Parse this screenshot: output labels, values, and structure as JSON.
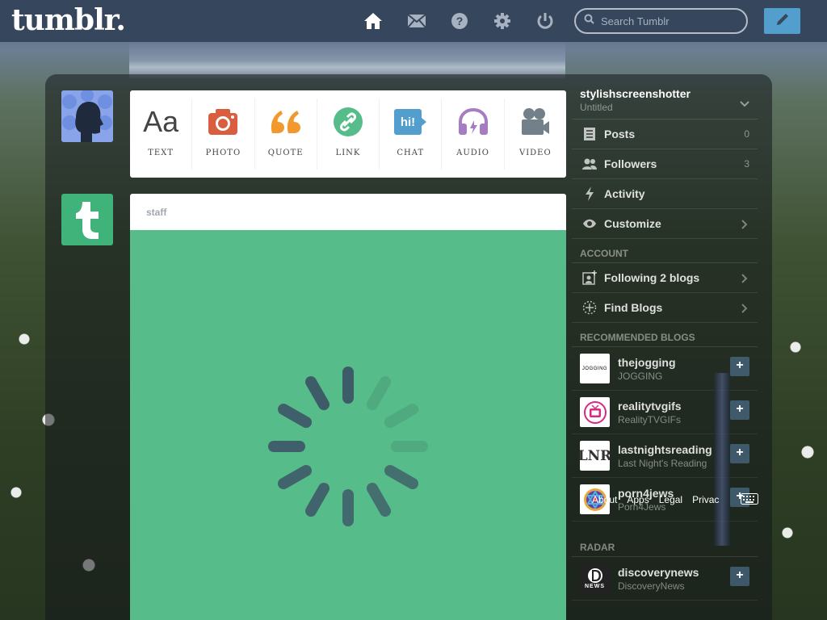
{
  "header": {
    "logo": "tumblr.",
    "search_placeholder": "Search Tumblr",
    "nav": [
      "home-icon",
      "mail-icon",
      "help-icon",
      "gear-icon",
      "power-icon"
    ]
  },
  "post_types": [
    {
      "label": "TEXT",
      "glyph": "Aa"
    },
    {
      "label": "PHOTO"
    },
    {
      "label": "QUOTE"
    },
    {
      "label": "LINK"
    },
    {
      "label": "CHAT",
      "glyph": "hi!"
    },
    {
      "label": "AUDIO"
    },
    {
      "label": "VIDEO"
    }
  ],
  "post": {
    "author": "staff"
  },
  "sidebar": {
    "blog_name": "stylishscreenshotter",
    "blog_title": "Untitled",
    "items": [
      {
        "label": "Posts",
        "count": "0"
      },
      {
        "label": "Followers",
        "count": "3"
      },
      {
        "label": "Activity"
      },
      {
        "label": "Customize"
      }
    ],
    "account_title": "ACCOUNT",
    "account_items": [
      {
        "label": "Following 2 blogs"
      },
      {
        "label": "Find Blogs"
      }
    ],
    "recommended_title": "RECOMMENDED BLOGS",
    "recommended": [
      {
        "name": "thejogging",
        "sub": "JOGGING",
        "thumb_text": "JOGGING"
      },
      {
        "name": "realitytvgifs",
        "sub": "RealityTVGIFs"
      },
      {
        "name": "lastnightsreading",
        "sub": "Last Night's Reading",
        "thumb_text": "LNR"
      },
      {
        "name": "porn4jews",
        "sub": "Porn4Jews"
      }
    ],
    "radar_title": "RADAR",
    "radar": [
      {
        "name": "discoverynews",
        "sub": "DiscoveryNews",
        "thumb_text": "NEWS"
      }
    ],
    "follow_glyph": "+",
    "footer_links": [
      "About",
      "Apps",
      "Legal",
      "Privac"
    ]
  },
  "colors": {
    "header_bg": "#36465d",
    "accent_blue": "#529ecc",
    "photo_red": "#d95e40",
    "quote_orange": "#f2992e",
    "link_green": "#56bc8a",
    "chat_blue": "#529ecc",
    "audio_purple": "#a77dc2",
    "video_gray": "#748089"
  }
}
